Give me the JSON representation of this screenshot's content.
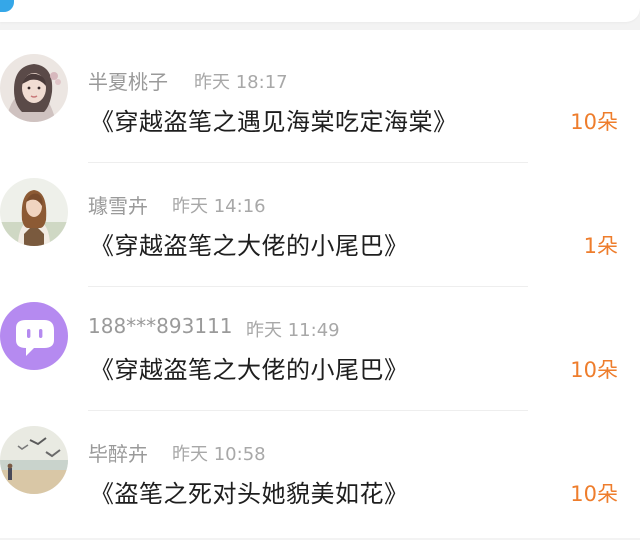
{
  "colors": {
    "accent_blue": "#35a7e8",
    "amount_orange": "#ee7d2c"
  },
  "gifts": [
    {
      "name": "半夏桃子",
      "time": "昨天 18:17",
      "book": "《穿越盗笔之遇见海棠吃定海棠》",
      "amount": "10朵",
      "avatar": "avatar-woman-hanfu"
    },
    {
      "name": "璩雪卉",
      "time": "昨天 14:16",
      "book": "《穿越盗笔之大佬的小尾巴》",
      "amount": "1朵",
      "avatar": "avatar-woman-photo"
    },
    {
      "name": "188***893111",
      "time": "昨天 11:49",
      "book": "《穿越盗笔之大佬的小尾巴》",
      "amount": "10朵",
      "avatar": "chat-bubble-icon"
    },
    {
      "name": "毕醉卉",
      "time": "昨天 10:58",
      "book": "《盗笔之死对头她貌美如花》",
      "amount": "10朵",
      "avatar": "avatar-beach-seagulls"
    }
  ]
}
